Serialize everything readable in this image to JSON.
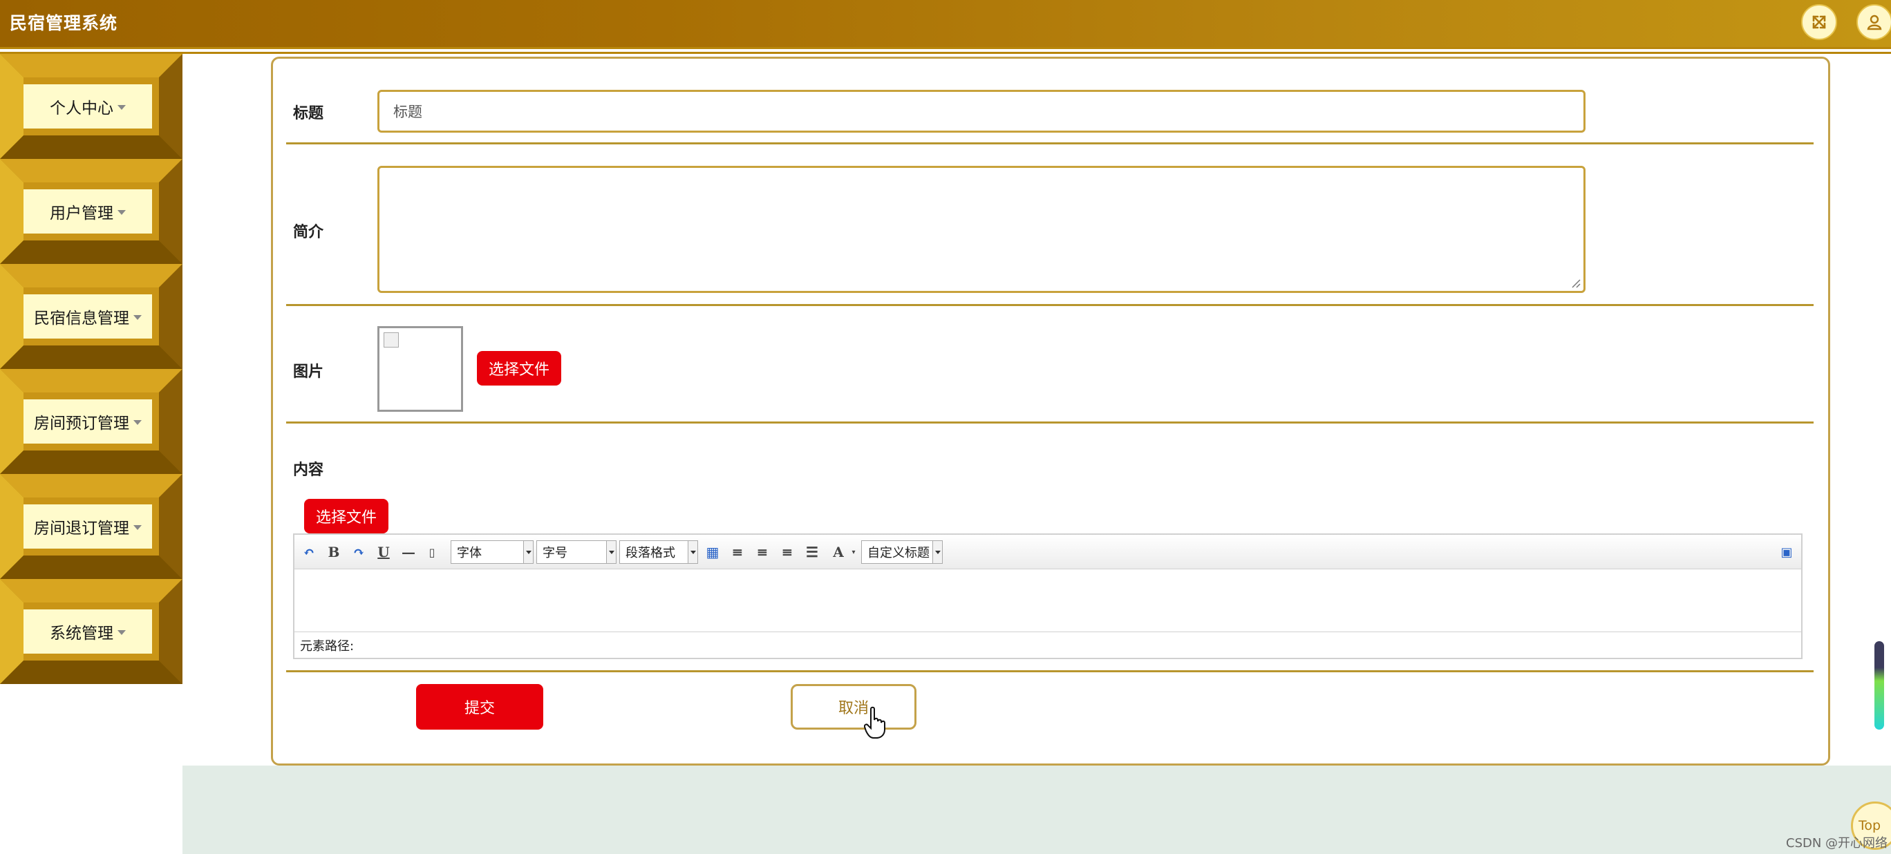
{
  "header": {
    "title": "民宿管理系统",
    "icons": [
      "fullscreen-icon",
      "user-icon"
    ]
  },
  "sidebar": {
    "items": [
      {
        "label": "个人中心"
      },
      {
        "label": "用户管理"
      },
      {
        "label": "民宿信息管理"
      },
      {
        "label": "房间预订管理"
      },
      {
        "label": "房间退订管理"
      },
      {
        "label": "系统管理"
      }
    ]
  },
  "form": {
    "title_label": "标题",
    "title_placeholder": "标题",
    "intro_label": "简介",
    "image_label": "图片",
    "image_upload_button": "选择文件",
    "content_label": "内容",
    "content_upload_button": "选择文件",
    "submit_label": "提交",
    "cancel_label": "取消"
  },
  "editor": {
    "font_select": "字体",
    "size_select": "字号",
    "paragraph_select": "段落格式",
    "custom_title_select": "自定义标题",
    "element_path": "元素路径:"
  },
  "footer": {
    "top_label": "Top",
    "watermark": "CSDN @开心网络"
  },
  "colors": {
    "brand_gold": "#b8860b",
    "accent_red": "#e8000b",
    "menu_label_bg": "#fffbcc"
  }
}
